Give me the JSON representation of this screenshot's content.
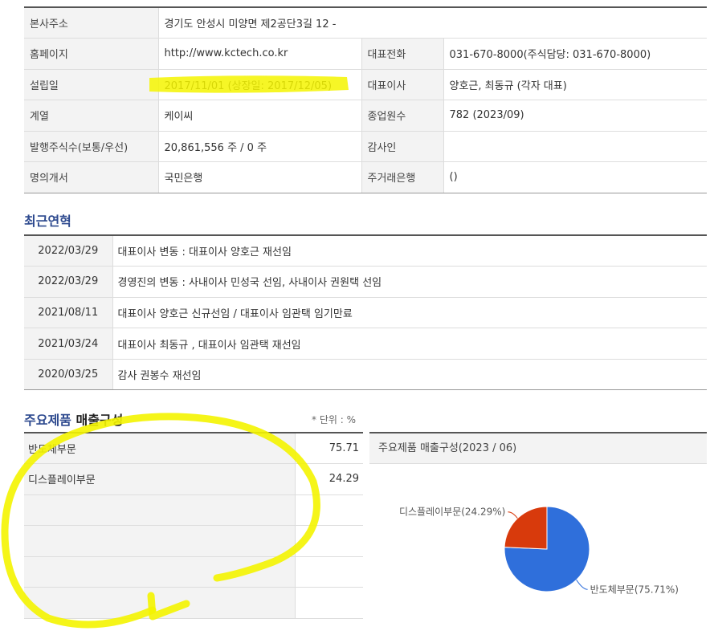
{
  "company_info": {
    "hq_address_label": "본사주소",
    "hq_address_value": "경기도 안성시 미양면 제2공단3길 12 -",
    "homepage_label": "홈페이지",
    "homepage_value": "http://www.kctech.co.kr",
    "phone_label": "대표전화",
    "phone_value": "031-670-8000(주식담당: 031-670-8000)",
    "founded_label": "설립일",
    "founded_value": "2017/11/01 (상장일: 2017/12/05)",
    "ceo_label": "대표이사",
    "ceo_value": "양호근, 최동규 (각자 대표)",
    "group_label": "계열",
    "group_value": "케이씨",
    "employees_label": "종업원수",
    "employees_value": "782 (2023/09)",
    "shares_label": "발행주식수(보통/우선)",
    "shares_value": "20,861,556 주 / 0 주",
    "auditor_label": "감사인",
    "auditor_value": "",
    "transfer_agent_label": "명의개서",
    "transfer_agent_value": "국민은행",
    "main_bank_label": "주거래은행",
    "main_bank_value": "()"
  },
  "history": {
    "title": "최근연혁",
    "rows": [
      {
        "date": "2022/03/29",
        "desc": "대표이사 변동 : 대표이사 양호근 재선임"
      },
      {
        "date": "2022/03/29",
        "desc": "경영진의 변동 : 사내이사 민성국 선임, 사내이사 권원택 선임"
      },
      {
        "date": "2021/08/11",
        "desc": "대표이사 양호근 신규선임 / 대표이사 임관택 임기만료"
      },
      {
        "date": "2021/03/24",
        "desc": "대표이사 최동규 , 대표이사 임관택 재선임"
      },
      {
        "date": "2020/03/25",
        "desc": "감사 권봉수 재선임"
      }
    ]
  },
  "products": {
    "title_blue": "주요제품",
    "title_dark": "매출구성",
    "unit": "* 단위 : %",
    "rows": [
      {
        "name": "반도체부문",
        "value": "75.71"
      },
      {
        "name": "디스플레이부문",
        "value": "24.29"
      },
      {
        "name": "",
        "value": ""
      },
      {
        "name": "",
        "value": ""
      },
      {
        "name": "",
        "value": ""
      },
      {
        "name": "",
        "value": ""
      }
    ]
  },
  "chart_panel": {
    "header": "주요제품 매출구성(2023 / 06)"
  },
  "chart_data": {
    "type": "pie",
    "slices": [
      {
        "name": "반도체부문",
        "value": 75.71,
        "label": "반도체부문(75.71%)",
        "color": "#2f6fdb"
      },
      {
        "name": "디스플레이부문",
        "value": 24.29,
        "label": "디스플레이부문(24.29%)",
        "color": "#d83a0c"
      }
    ]
  },
  "colors": {
    "header_bg": "#f3f3f3",
    "section_title_blue": "#2e4a8f",
    "annotation_yellow": "#f4f400"
  }
}
